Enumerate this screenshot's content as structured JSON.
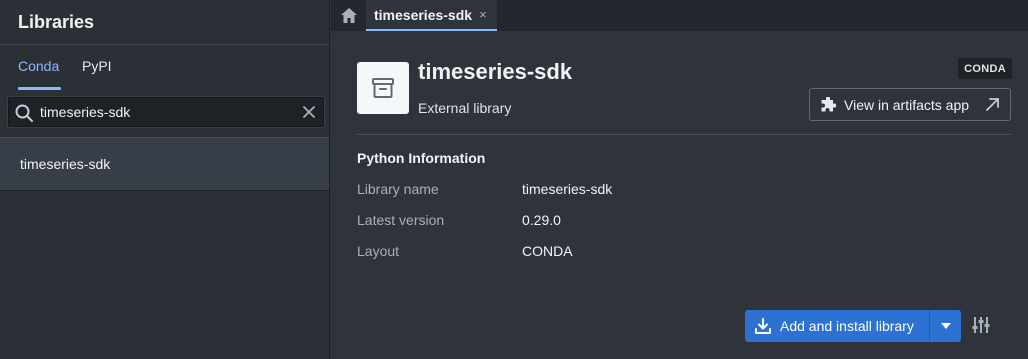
{
  "sidebar": {
    "title": "Libraries",
    "tabs": [
      {
        "label": "Conda",
        "active": true
      },
      {
        "label": "PyPI",
        "active": false
      }
    ],
    "search": {
      "value": "timeseries-sdk",
      "placeholder": ""
    },
    "results": [
      {
        "label": "timeseries-sdk"
      }
    ]
  },
  "tabbar": {
    "home_icon": "home-icon",
    "tabs": [
      {
        "label": "timeseries-sdk",
        "close": "×"
      }
    ]
  },
  "library": {
    "icon": "box-icon",
    "name": "timeseries-sdk",
    "subtitle": "External library",
    "badge": "CONDA",
    "artifacts_button": "View in artifacts app"
  },
  "python_info": {
    "title": "Python Information",
    "rows": [
      {
        "label": "Library name",
        "value": "timeseries-sdk"
      },
      {
        "label": "Latest version",
        "value": "0.29.0"
      },
      {
        "label": "Layout",
        "value": "CONDA"
      }
    ]
  },
  "actions": {
    "install_button": "Add and install library"
  },
  "colors": {
    "accent": "#8abbff",
    "primary_button": "#2d72d2",
    "background": "#2f343c",
    "sidebar": "#2b2f36"
  }
}
